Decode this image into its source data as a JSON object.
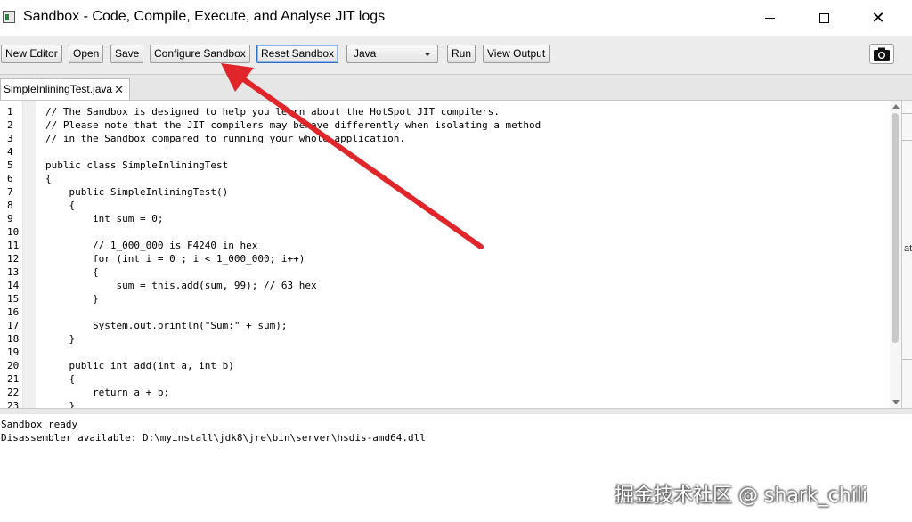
{
  "window": {
    "title": "Sandbox - Code, Compile, Execute, and Analyse JIT logs",
    "minimize_icon": "minimize-icon",
    "maximize_icon": "maximize-icon",
    "close_glyph": "✕"
  },
  "toolbar": {
    "new_editor": "New Editor",
    "open": "Open",
    "save": "Save",
    "configure_sandbox": "Configure Sandbox",
    "reset_sandbox": "Reset Sandbox",
    "language_selected": "Java",
    "run": "Run",
    "view_output": "View Output",
    "snapshot_icon": "camera-icon"
  },
  "tabs": [
    {
      "label": "SimpleInliningTest.java",
      "close_glyph": "✕"
    }
  ],
  "editor": {
    "line_numbers": [
      "1",
      "2",
      "3",
      "4",
      "5",
      "6",
      "7",
      "8",
      "9",
      "10",
      "11",
      "12",
      "13",
      "14",
      "15",
      "16",
      "17",
      "18",
      "19",
      "20",
      "21",
      "22",
      "23"
    ],
    "code_lines": [
      "// The Sandbox is designed to help you learn about the HotSpot JIT compilers.",
      "// Please note that the JIT compilers may behave differently when isolating a method",
      "// in the Sandbox compared to running your whole application.",
      "",
      "public class SimpleInliningTest",
      "{",
      "    public SimpleInliningTest()",
      "    {",
      "        int sum = 0;",
      "",
      "        // 1_000_000 is F4240 in hex",
      "        for (int i = 0 ; i < 1_000_000; i++)",
      "        {",
      "            sum = this.add(sum, 99); // 63 hex",
      "        }",
      "",
      "        System.out.println(\"Sum:\" + sum);",
      "    }",
      "",
      "    public int add(int a, int b)",
      "    {",
      "        return a + b;",
      "    }"
    ]
  },
  "background_window_fragment": "at",
  "output": {
    "lines": [
      "Sandbox ready",
      "Disassembler available: D:\\myinstall\\jdk8\\jre\\bin\\server\\hsdis-amd64.dll"
    ]
  },
  "watermark": "掘金技术社区 @ shark_chili",
  "annotation": {
    "arrow_color": "#e0262b"
  },
  "colors": {
    "toolbar_bg": "#ececec",
    "focus_border": "#2f6fbf"
  }
}
